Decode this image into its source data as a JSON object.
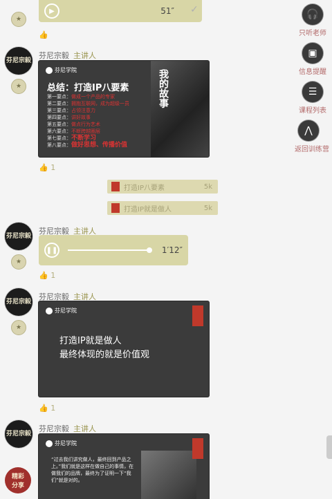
{
  "sidebar": [
    {
      "label": "只听老师",
      "icon": "headphones-icon"
    },
    {
      "label": "信息提醒",
      "icon": "bell-icon"
    },
    {
      "label": "课程列表",
      "icon": "list-icon"
    },
    {
      "label": "返回训练营",
      "icon": "home-icon"
    }
  ],
  "messages": [
    {
      "type": "audio",
      "duration": "51″"
    },
    {
      "sender": "芬尼宗毅",
      "role": "主讲人",
      "type": "slide1",
      "likes": "1"
    },
    {
      "sender": "芬尼宗毅",
      "role": "主讲人",
      "type": "audio",
      "duration": "1′12″",
      "likes": "1"
    },
    {
      "sender": "芬尼宗毅",
      "role": "主讲人",
      "type": "slide2",
      "likes": "1"
    },
    {
      "sender": "芬尼宗毅",
      "role": "主讲人",
      "type": "slide3"
    }
  ],
  "files": [
    {
      "name": "打造IP八要素",
      "size": "5k"
    },
    {
      "name": "打造IP就是做人",
      "size": "5k"
    }
  ],
  "slide1": {
    "logo": "芬尼学院",
    "title": "总结：打造IP八要素",
    "side_text": "我的故事",
    "lines": [
      {
        "label": "第一要点：",
        "text": "做成一个产品的专家"
      },
      {
        "label": "第二要点：",
        "text": "拥抱互联网，成为超级一员"
      },
      {
        "label": "第三要点：",
        "text": "占领注意力"
      },
      {
        "label": "第四要点：",
        "text": "讲好故事"
      },
      {
        "label": "第五要点：",
        "text": "做点行为艺术"
      },
      {
        "label": "第六要点：",
        "text": "不断跨越圈层"
      },
      {
        "label": "第七要点：",
        "text": "不断学习"
      },
      {
        "label": "第八要点：",
        "text": "做好思想、传播价值"
      }
    ]
  },
  "slide2": {
    "logo": "芬尼学院",
    "line1": "打造IP就是做人",
    "line2": "最终体现的就是价值观"
  },
  "slide3": {
    "logo": "芬尼学院",
    "text": "“过去我们讲究做人，最终回到产品之上。”我们就是这样在做自己的事情，在做我们的品牌，最终为了证明一下“我们”就是对的。"
  },
  "avatar_text": "芬尼宗毅"
}
